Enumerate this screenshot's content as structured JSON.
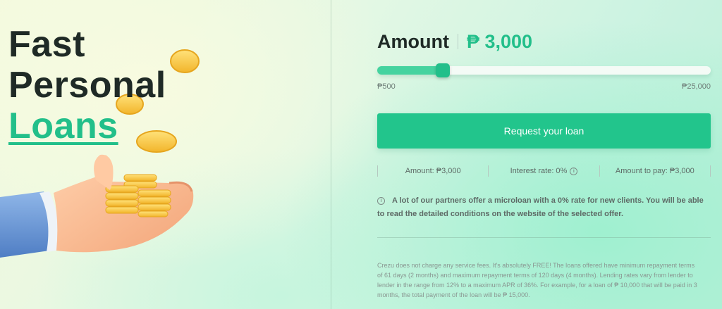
{
  "hero": {
    "title_line1": "Fast",
    "title_line2": "Personal",
    "title_line3": "Loans"
  },
  "calculator": {
    "amount_label": "Amount",
    "amount_value": "₱ 3,000",
    "slider": {
      "min_label": "₱500",
      "max_label": "₱25,000",
      "min": 500,
      "max": 25000,
      "value": 3000
    },
    "cta_label": "Request your loan",
    "stats": {
      "amount": "Amount: ₱3,000",
      "interest": "Interest rate: 0%",
      "to_pay": "Amount to pay: ₱3,000"
    },
    "notice": "A lot of our partners offer a microloan with a 0% rate for new clients. You will be able to read the detailed conditions on the website of the selected offer.",
    "disclaimer": "Crezu does not charge any service fees. It's absolutely FREE! The loans offered have minimum repayment terms of 61 days (2 months) and maximum repayment terms of 120 days (4 months). Lending rates vary from lender to lender in the range from 12% to a maximum APR of 36%. For example, for a loan of ₱ 10,000 that will be paid in 3 months, the total payment of the loan will be ₱ 15,000."
  },
  "colors": {
    "accent": "#22bf8a",
    "text_dark": "#1f2a26",
    "cta": "#22c58c"
  },
  "icons": [
    "info-icon",
    "coin-icon",
    "hand-icon"
  ]
}
